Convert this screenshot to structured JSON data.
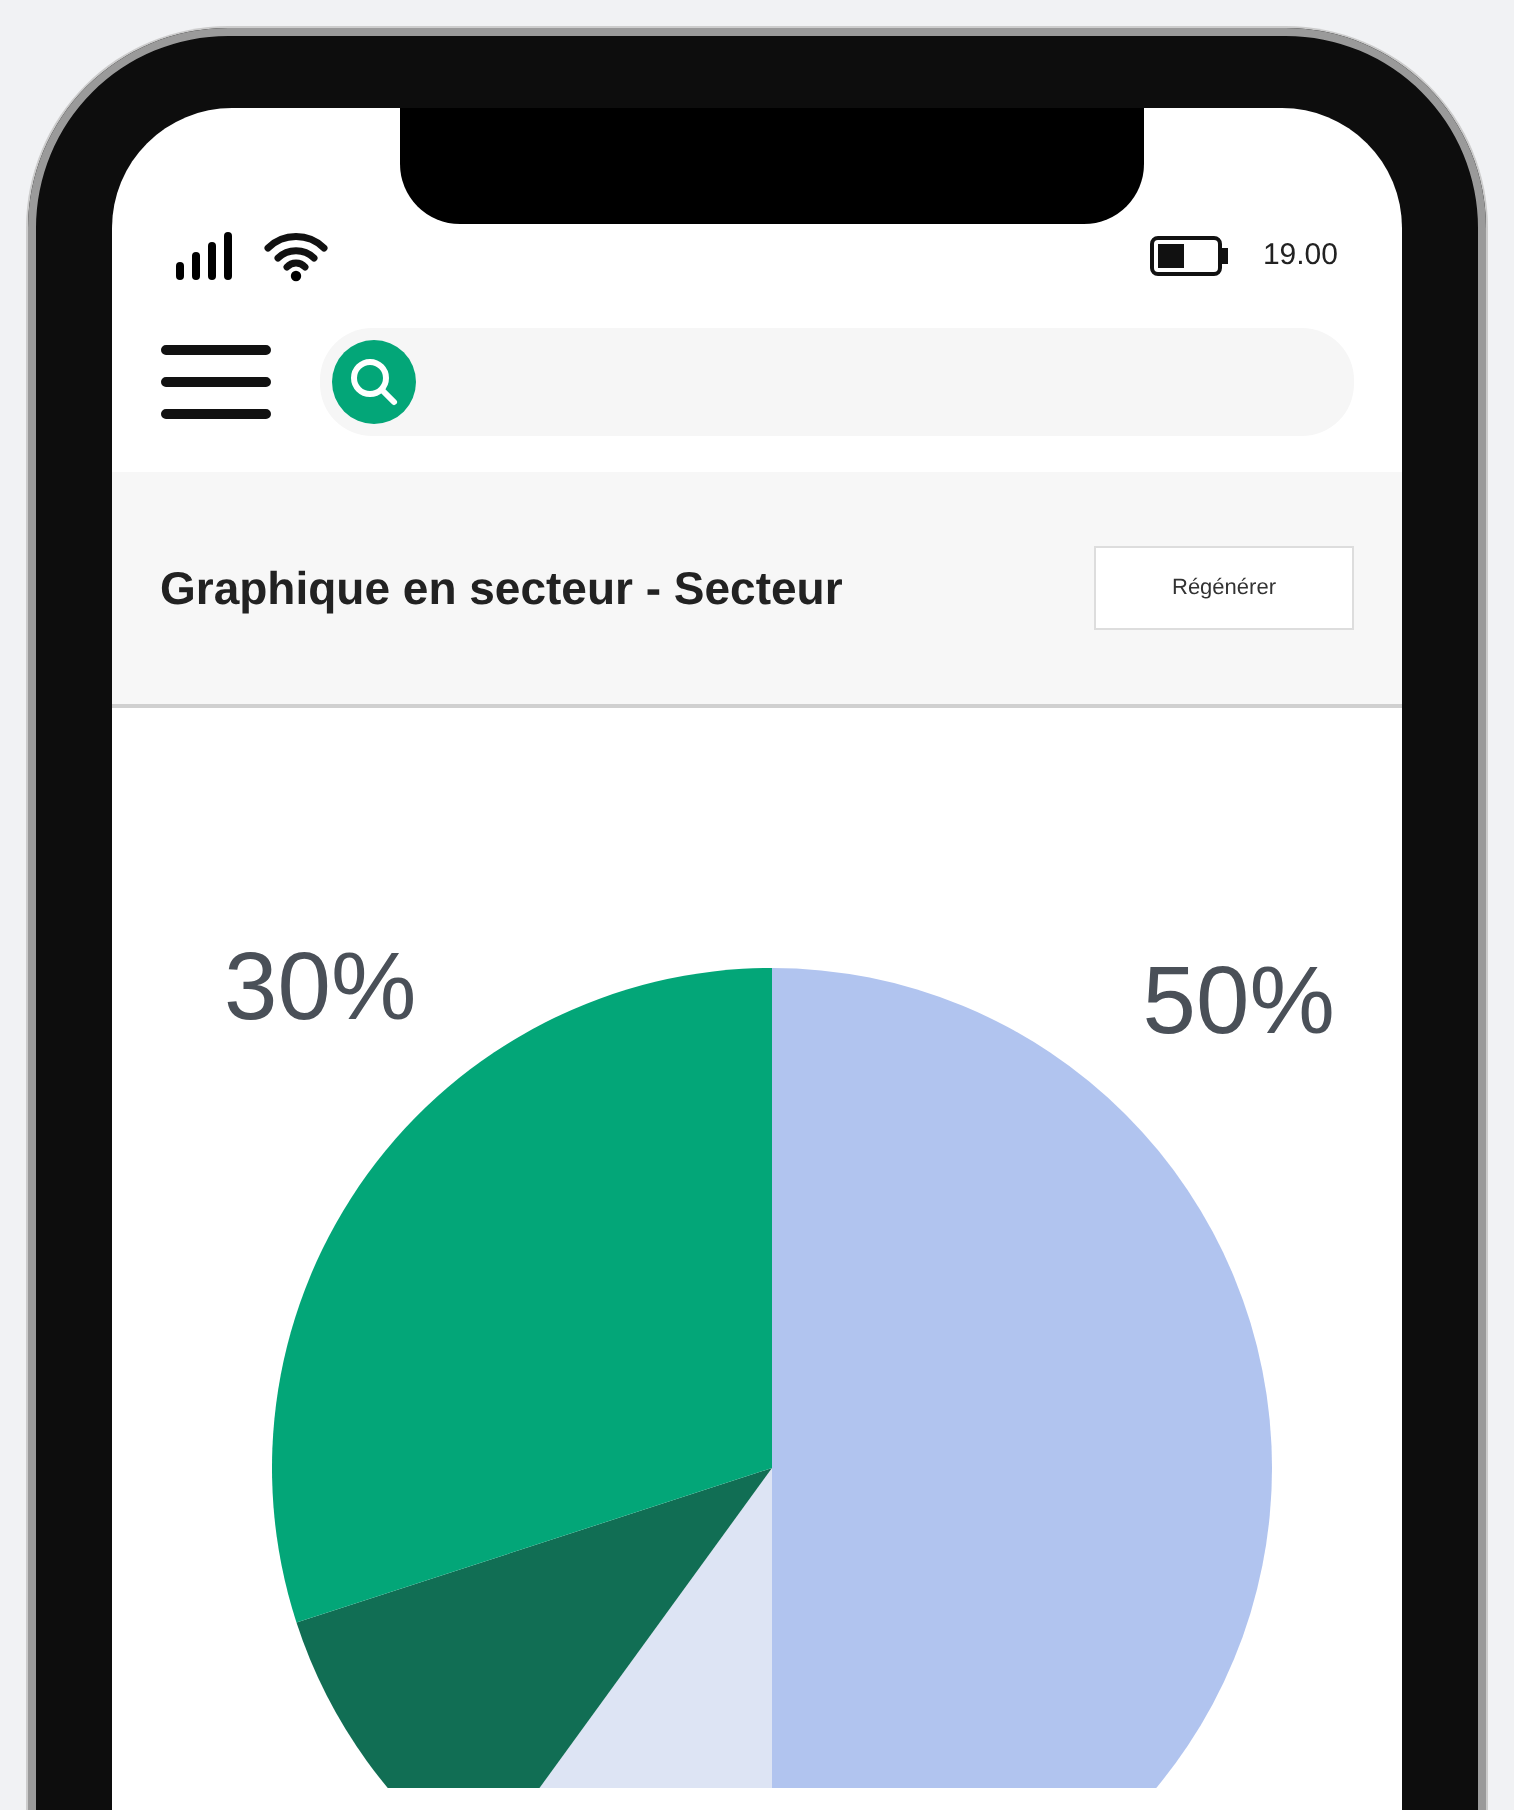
{
  "status_bar": {
    "time": "19.00"
  },
  "card": {
    "title": "Graphique en secteur - Secteur",
    "button": "Régénérer",
    "chart_data": {
      "type": "pie",
      "values": [
        50,
        10,
        10,
        30
      ],
      "colors": [
        "#b1c4ef",
        "#dde4f4",
        "#116e54",
        "#03a678"
      ],
      "value_labels": [
        "50%",
        null,
        null,
        "30%"
      ]
    }
  }
}
